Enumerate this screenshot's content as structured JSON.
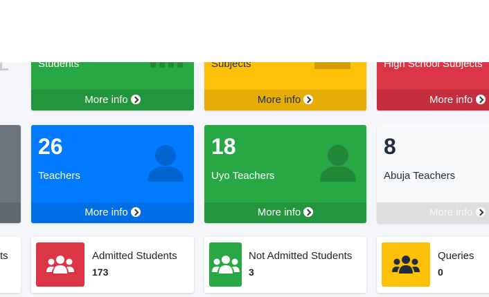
{
  "row1": [
    {
      "label": "Students",
      "footer": "More info",
      "color": "#28a745"
    },
    {
      "label": "Subjects",
      "footer": "More info",
      "color": "#ffc107"
    },
    {
      "label": "High School Subjects",
      "footer": "More info",
      "color": "#dc3545"
    }
  ],
  "row2": [
    {
      "number": "26",
      "label": "Teachers",
      "footer": "More info",
      "color": "#007bff"
    },
    {
      "number": "18",
      "label": "Uyo Teachers",
      "footer": "More info",
      "color": "#28a745"
    },
    {
      "number": "8",
      "label": "Abuja Teachers",
      "footer": "More info",
      "color": "#f8f9fa"
    }
  ],
  "row3": [
    {
      "partial_label": "ts"
    },
    {
      "label": "Admitted Students",
      "value": "173",
      "icon": "users-icon",
      "color": "#dc3545"
    },
    {
      "label": "Not Admitted Students",
      "value": "3",
      "icon": "users-icon",
      "color": "#28a745"
    },
    {
      "label": "Queries",
      "value": "0",
      "icon": "users-icon",
      "color": "#ffc107"
    }
  ]
}
